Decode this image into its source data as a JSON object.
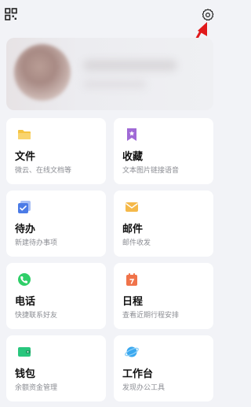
{
  "topbar": {
    "left_icon": "qr-code-icon",
    "right_icon": "gear-icon"
  },
  "cards": [
    {
      "title": "文件",
      "subtitle": "微云、在线文档等",
      "icon": "folder-icon",
      "color": "#f5c443"
    },
    {
      "title": "收藏",
      "subtitle": "文本图片链接语音",
      "icon": "bookmark-icon",
      "color": "#a06ad6"
    },
    {
      "title": "待办",
      "subtitle": "新建待办事项",
      "icon": "todo-icon",
      "color": "#4b7be6"
    },
    {
      "title": "邮件",
      "subtitle": "邮件收发",
      "icon": "mail-icon",
      "color": "#f5b94a"
    },
    {
      "title": "电话",
      "subtitle": "快捷联系好友",
      "icon": "phone-icon",
      "color": "#2fcf68"
    },
    {
      "title": "日程",
      "subtitle": "查看近期行程安排",
      "icon": "calendar-icon",
      "color": "#f0734a"
    },
    {
      "title": "钱包",
      "subtitle": "余额资金管理",
      "icon": "wallet-icon",
      "color": "#29c67d"
    },
    {
      "title": "工作台",
      "subtitle": "发现办公工具",
      "icon": "planet-icon",
      "color": "#3aa8ef"
    }
  ],
  "annotation_color": "#e0191b"
}
